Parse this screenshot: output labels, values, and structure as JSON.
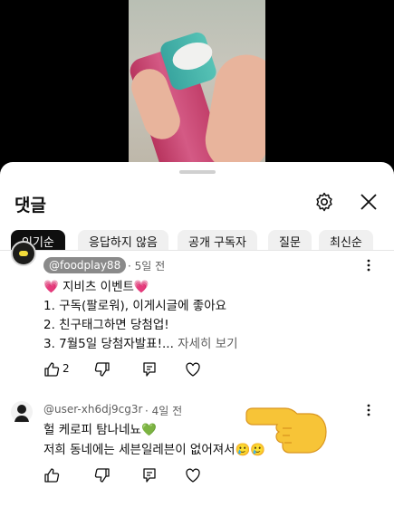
{
  "sheet": {
    "title": "댓글",
    "chips": [
      {
        "label": "인기순",
        "active": true
      },
      {
        "label": "응답하지 않음",
        "active": false
      },
      {
        "label": "공개 구독자",
        "active": false
      },
      {
        "label": "질문",
        "active": false
      },
      {
        "label": "최신순",
        "active": false
      }
    ]
  },
  "comments": [
    {
      "author": "@foodplay88",
      "time": "· 5일 전",
      "lines": [
        "💗 지비츠 이벤트💗",
        "1. 구독(팔로워), 이게시글에 좋아요",
        "2. 친구태그하면 당첨업!",
        "3. 7월5일 당첨자발표!..."
      ],
      "read_more": "자세히 보기",
      "likes": "2"
    },
    {
      "author": "@user-xh6dj9cg3r",
      "time": "· 4일 전",
      "lines": [
        "헐 케로피 탐나네뇨💚",
        "저희 동네에는 세븐일레븐이 없어져서🥲🥲"
      ],
      "likes": ""
    }
  ],
  "icons": {
    "settings": "gear-icon",
    "close": "close-icon",
    "like": "thumb-up-icon",
    "dislike": "thumb-down-icon",
    "reply": "reply-icon",
    "heart": "heart-icon",
    "more": "more-vertical-icon"
  }
}
